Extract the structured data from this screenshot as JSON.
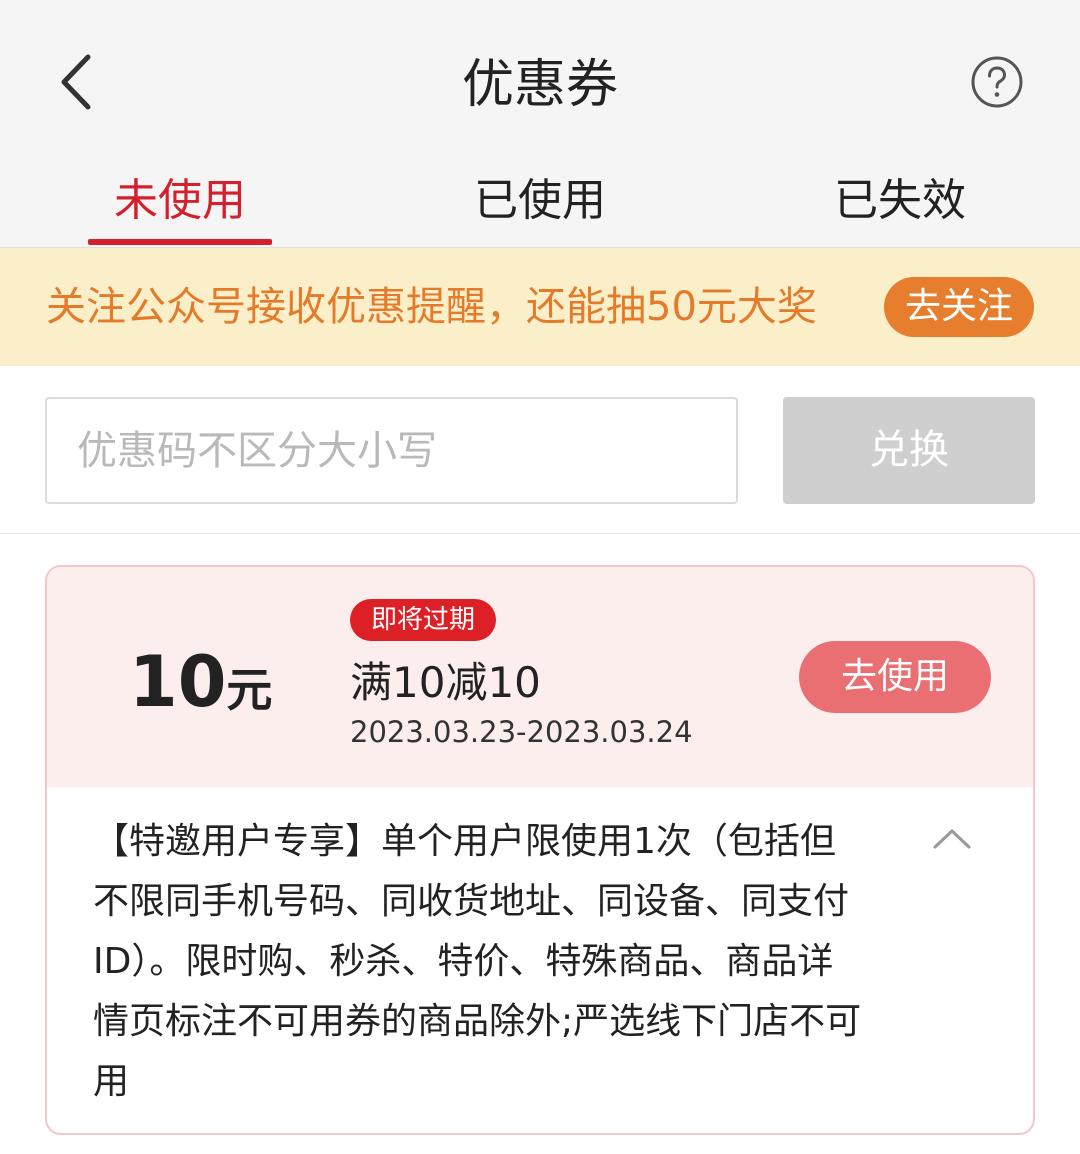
{
  "header": {
    "title": "优惠券",
    "back_icon": "chevron-left-icon",
    "help_icon": "question-circle-icon"
  },
  "tabs": [
    {
      "label": "未使用",
      "active": true
    },
    {
      "label": "已使用",
      "active": false
    },
    {
      "label": "已失效",
      "active": false
    }
  ],
  "banner": {
    "text": "关注公众号接收优惠提醒，还能抽50元大奖",
    "button_label": "去关注"
  },
  "redeem": {
    "placeholder": "优惠码不区分大小写",
    "value": "",
    "button_label": "兑换"
  },
  "coupon": {
    "amount": "10",
    "unit": "元",
    "badge": "即将过期",
    "name": "满10减10",
    "date_range": "2023.03.23-2023.03.24",
    "use_button": "去使用",
    "description": "【特邀用户专享】单个用户限使用1次（包括但不限同手机号码、同收货地址、同设备、同支付ID）。限时购、秒杀、特价、特殊商品、商品详情页标注不可用券的商品除外;严选线下门店不可用",
    "collapse_icon": "chevron-up-icon"
  },
  "colors": {
    "accent_red": "#d4202c",
    "banner_bg": "#fbefc9",
    "banner_text": "#e47b2a",
    "follow_button": "#e67e2e",
    "use_button": "#ea6f73",
    "badge": "#dd1f26",
    "coupon_bg": "#fdeeee"
  }
}
